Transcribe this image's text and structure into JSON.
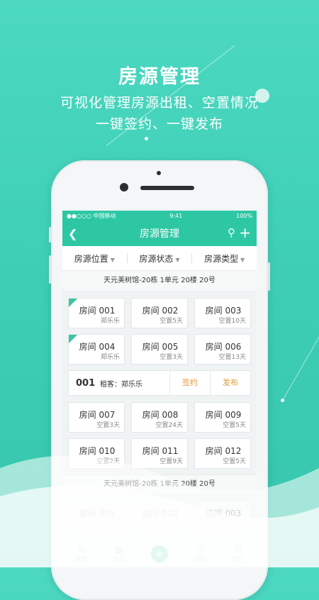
{
  "promo": {
    "headline": "房源管理",
    "subline1": "可视化管理房源出租、空置情况",
    "subline2": "一键签约、一键发布"
  },
  "status_bar": {
    "carrier": "●●○○○ 中国移动",
    "time": "9:41",
    "battery": "100%"
  },
  "nav": {
    "back_icon": "chevron-left-icon",
    "title": "房源管理",
    "search_icon": "search-icon",
    "add_icon": "plus-icon"
  },
  "filters": [
    {
      "label": "房源位置"
    },
    {
      "label": "房源状态"
    },
    {
      "label": "房源类型"
    }
  ],
  "buildings": [
    {
      "label": "天元美树馆-20栋 1单元 20楼 20号"
    },
    {
      "label": "天元美树馆-20栋 1单元 20楼 20号"
    }
  ],
  "rooms_row1": [
    {
      "name": "房间 001",
      "info": "郑乐乐",
      "rented": true
    },
    {
      "name": "房间 002",
      "info": "空置5天",
      "rented": false
    },
    {
      "name": "房间 003",
      "info": "空置10天",
      "rented": false
    }
  ],
  "rooms_row2": [
    {
      "name": "房间 004",
      "info": "郑乐乐",
      "rented": true
    },
    {
      "name": "房间 005",
      "info": "空置3天",
      "rented": false
    },
    {
      "name": "房间 006",
      "info": "空置13天",
      "rented": false
    }
  ],
  "detail": {
    "number": "001",
    "tenant": "租客：郑乐乐",
    "sign_label": "签约",
    "publish_label": "发布"
  },
  "rooms_row3": [
    {
      "name": "房间 007",
      "info": "空置3天"
    },
    {
      "name": "房间 008",
      "info": "空置24天"
    },
    {
      "name": "房间 009",
      "info": "空置5天"
    }
  ],
  "rooms_row4": [
    {
      "name": "房间 010",
      "info": "空置2天"
    },
    {
      "name": "房间 011",
      "info": "空置9天"
    },
    {
      "name": "房间 012",
      "info": "空置5天"
    }
  ],
  "rooms_row5": [
    {
      "name": "房间 001"
    },
    {
      "name": "房间 002"
    },
    {
      "name": "房间 003"
    }
  ],
  "tabbar": [
    {
      "label": "首页",
      "icon": "home-icon"
    },
    {
      "label": "房源",
      "icon": "building-icon"
    },
    {
      "label": "",
      "icon": "plus-icon"
    },
    {
      "label": "消息",
      "icon": "clock-icon"
    },
    {
      "label": "我的",
      "icon": "user-icon"
    }
  ]
}
